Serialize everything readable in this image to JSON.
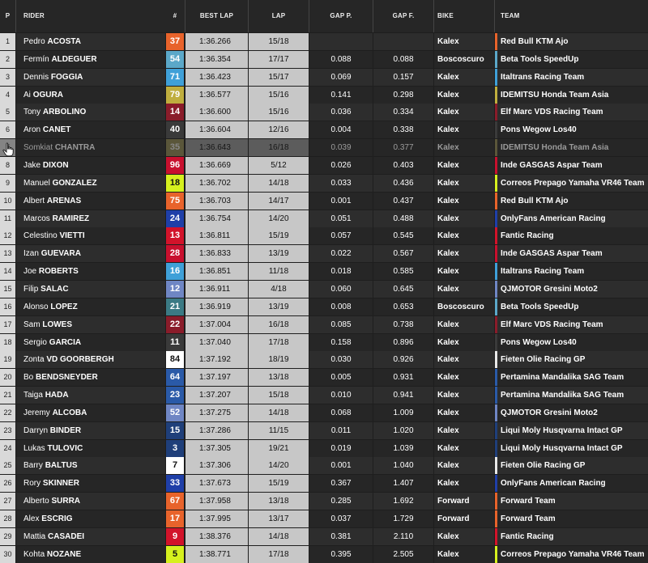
{
  "header": {
    "pos": "P",
    "rider": "RIDER",
    "num": "#",
    "best_lap": "BEST LAP",
    "lap": "LAP",
    "gap_p": "GAP P.",
    "gap_f": "GAP F.",
    "bike": "BIKE",
    "team": "TEAM"
  },
  "rows": [
    {
      "pos": "1",
      "first": "Pedro",
      "last": "ACOSTA",
      "num": "37",
      "num_bg": "#e8632b",
      "num_fg": "#ffffff",
      "best": "1:36.266",
      "lap": "15/18",
      "gap_p": "",
      "gap_f": "",
      "bike": "Kalex",
      "team": "Red Bull KTM Ajo",
      "team_color": "#e8632b"
    },
    {
      "pos": "2",
      "first": "Fermín",
      "last": "ALDEGUER",
      "num": "54",
      "num_bg": "#5ba8c9",
      "num_fg": "#ffffff",
      "best": "1:36.354",
      "lap": "17/17",
      "gap_p": "0.088",
      "gap_f": "0.088",
      "bike": "Boscoscuro",
      "team": "Beta Tools SpeedUp",
      "team_color": "#5ba8c9"
    },
    {
      "pos": "3",
      "first": "Dennis",
      "last": "FOGGIA",
      "num": "71",
      "num_bg": "#3fa0d8",
      "num_fg": "#ffffff",
      "best": "1:36.423",
      "lap": "15/17",
      "gap_p": "0.069",
      "gap_f": "0.157",
      "bike": "Kalex",
      "team": "Italtrans Racing Team",
      "team_color": "#3fa0d8"
    },
    {
      "pos": "4",
      "first": "Ai",
      "last": "OGURA",
      "num": "79",
      "num_bg": "#bfae3e",
      "num_fg": "#ffffff",
      "best": "1:36.577",
      "lap": "15/16",
      "gap_p": "0.141",
      "gap_f": "0.298",
      "bike": "Kalex",
      "team": "IDEMITSU Honda Team Asia",
      "team_color": "#bfae3e"
    },
    {
      "pos": "5",
      "first": "Tony",
      "last": "ARBOLINO",
      "num": "14",
      "num_bg": "#8a1c2a",
      "num_fg": "#ffffff",
      "best": "1:36.600",
      "lap": "15/16",
      "gap_p": "0.036",
      "gap_f": "0.334",
      "bike": "Kalex",
      "team": "Elf Marc VDS Racing Team",
      "team_color": "#8a1c2a"
    },
    {
      "pos": "6",
      "first": "Aron",
      "last": "CANET",
      "num": "40",
      "num_bg": "#3a3a3a",
      "num_fg": "#ffffff",
      "best": "1:36.604",
      "lap": "12/16",
      "gap_p": "0.004",
      "gap_f": "0.338",
      "bike": "Kalex",
      "team": "Pons Wegow Los40",
      "team_color": "#3a3a3a"
    },
    {
      "pos": "7",
      "first": "Somkiat",
      "last": "CHANTRA",
      "num": "35",
      "num_bg": "#8c8452",
      "num_fg": "#dddddd",
      "best": "1:36.643",
      "lap": "16/18",
      "gap_p": "0.039",
      "gap_f": "0.377",
      "bike": "Kalex",
      "team": "IDEMITSU Honda Team Asia",
      "team_color": "#8c8452",
      "dim": true
    },
    {
      "pos": "8",
      "first": "Jake",
      "last": "DIXON",
      "num": "96",
      "num_bg": "#c8102e",
      "num_fg": "#ffffff",
      "best": "1:36.669",
      "lap": "5/12",
      "gap_p": "0.026",
      "gap_f": "0.403",
      "bike": "Kalex",
      "team": "Inde GASGAS Aspar Team",
      "team_color": "#c8102e"
    },
    {
      "pos": "9",
      "first": "Manuel",
      "last": "GONZALEZ",
      "num": "18",
      "num_bg": "#d6f01e",
      "num_fg": "#111111",
      "best": "1:36.702",
      "lap": "14/18",
      "gap_p": "0.033",
      "gap_f": "0.436",
      "bike": "Kalex",
      "team": "Correos Prepago Yamaha VR46 Team",
      "team_color": "#d6f01e"
    },
    {
      "pos": "10",
      "first": "Albert",
      "last": "ARENAS",
      "num": "75",
      "num_bg": "#e8632b",
      "num_fg": "#ffffff",
      "best": "1:36.703",
      "lap": "14/17",
      "gap_p": "0.001",
      "gap_f": "0.437",
      "bike": "Kalex",
      "team": "Red Bull KTM Ajo",
      "team_color": "#e8632b"
    },
    {
      "pos": "11",
      "first": "Marcos",
      "last": "RAMIREZ",
      "num": "24",
      "num_bg": "#1f3fa8",
      "num_fg": "#ffffff",
      "best": "1:36.754",
      "lap": "14/20",
      "gap_p": "0.051",
      "gap_f": "0.488",
      "bike": "Kalex",
      "team": "OnlyFans American Racing",
      "team_color": "#1f3fa8"
    },
    {
      "pos": "12",
      "first": "Celestino",
      "last": "VIETTI",
      "num": "13",
      "num_bg": "#d2132a",
      "num_fg": "#ffffff",
      "best": "1:36.811",
      "lap": "15/19",
      "gap_p": "0.057",
      "gap_f": "0.545",
      "bike": "Kalex",
      "team": "Fantic Racing",
      "team_color": "#d2132a"
    },
    {
      "pos": "13",
      "first": "Izan",
      "last": "GUEVARA",
      "num": "28",
      "num_bg": "#c8102e",
      "num_fg": "#ffffff",
      "best": "1:36.833",
      "lap": "13/19",
      "gap_p": "0.022",
      "gap_f": "0.567",
      "bike": "Kalex",
      "team": "Inde GASGAS Aspar Team",
      "team_color": "#c8102e"
    },
    {
      "pos": "14",
      "first": "Joe",
      "last": "ROBERTS",
      "num": "16",
      "num_bg": "#3fa0d8",
      "num_fg": "#ffffff",
      "best": "1:36.851",
      "lap": "11/18",
      "gap_p": "0.018",
      "gap_f": "0.585",
      "bike": "Kalex",
      "team": "Italtrans Racing Team",
      "team_color": "#3fa0d8"
    },
    {
      "pos": "15",
      "first": "Filip",
      "last": "SALAC",
      "num": "12",
      "num_bg": "#6f86c4",
      "num_fg": "#ffffff",
      "best": "1:36.911",
      "lap": "4/18",
      "gap_p": "0.060",
      "gap_f": "0.645",
      "bike": "Kalex",
      "team": "QJMOTOR Gresini Moto2",
      "team_color": "#6f86c4"
    },
    {
      "pos": "16",
      "first": "Alonso",
      "last": "LOPEZ",
      "num": "21",
      "num_bg": "#3b7a84",
      "num_fg": "#ffffff",
      "best": "1:36.919",
      "lap": "13/19",
      "gap_p": "0.008",
      "gap_f": "0.653",
      "bike": "Boscoscuro",
      "team": "Beta Tools SpeedUp",
      "team_color": "#5ba8c9"
    },
    {
      "pos": "17",
      "first": "Sam",
      "last": "LOWES",
      "num": "22",
      "num_bg": "#8a1c2a",
      "num_fg": "#ffffff",
      "best": "1:37.004",
      "lap": "16/18",
      "gap_p": "0.085",
      "gap_f": "0.738",
      "bike": "Kalex",
      "team": "Elf Marc VDS Racing Team",
      "team_color": "#8a1c2a"
    },
    {
      "pos": "18",
      "first": "Sergio",
      "last": "GARCIA",
      "num": "11",
      "num_bg": "#3a3a3a",
      "num_fg": "#ffffff",
      "best": "1:37.040",
      "lap": "17/18",
      "gap_p": "0.158",
      "gap_f": "0.896",
      "bike": "Kalex",
      "team": "Pons Wegow Los40",
      "team_color": "#3a3a3a"
    },
    {
      "pos": "19",
      "first": "Zonta",
      "last": "VD GOORBERGH",
      "num": "84",
      "num_bg": "#ffffff",
      "num_fg": "#111111",
      "best": "1:37.192",
      "lap": "18/19",
      "gap_p": "0.030",
      "gap_f": "0.926",
      "bike": "Kalex",
      "team": "Fieten Olie Racing GP",
      "team_color": "#e8e8e8"
    },
    {
      "pos": "20",
      "first": "Bo",
      "last": "BENDSNEYDER",
      "num": "64",
      "num_bg": "#2a5aa8",
      "num_fg": "#ffffff",
      "best": "1:37.197",
      "lap": "13/18",
      "gap_p": "0.005",
      "gap_f": "0.931",
      "bike": "Kalex",
      "team": "Pertamina Mandalika SAG Team",
      "team_color": "#2a5aa8"
    },
    {
      "pos": "21",
      "first": "Taiga",
      "last": "HADA",
      "num": "23",
      "num_bg": "#2a5aa8",
      "num_fg": "#ffffff",
      "best": "1:37.207",
      "lap": "15/18",
      "gap_p": "0.010",
      "gap_f": "0.941",
      "bike": "Kalex",
      "team": "Pertamina Mandalika SAG Team",
      "team_color": "#2a5aa8"
    },
    {
      "pos": "22",
      "first": "Jeremy",
      "last": "ALCOBA",
      "num": "52",
      "num_bg": "#6f86c4",
      "num_fg": "#ffffff",
      "best": "1:37.275",
      "lap": "14/18",
      "gap_p": "0.068",
      "gap_f": "1.009",
      "bike": "Kalex",
      "team": "QJMOTOR Gresini Moto2",
      "team_color": "#6f86c4"
    },
    {
      "pos": "23",
      "first": "Darryn",
      "last": "BINDER",
      "num": "15",
      "num_bg": "#1f3f7a",
      "num_fg": "#ffffff",
      "best": "1:37.286",
      "lap": "11/15",
      "gap_p": "0.011",
      "gap_f": "1.020",
      "bike": "Kalex",
      "team": "Liqui Moly Husqvarna Intact GP",
      "team_color": "#1f3f7a"
    },
    {
      "pos": "24",
      "first": "Lukas",
      "last": "TULOVIC",
      "num": "3",
      "num_bg": "#1f3f7a",
      "num_fg": "#ffffff",
      "best": "1:37.305",
      "lap": "19/21",
      "gap_p": "0.019",
      "gap_f": "1.039",
      "bike": "Kalex",
      "team": "Liqui Moly Husqvarna Intact GP",
      "team_color": "#1f3f7a"
    },
    {
      "pos": "25",
      "first": "Barry",
      "last": "BALTUS",
      "num": "7",
      "num_bg": "#ffffff",
      "num_fg": "#111111",
      "best": "1:37.306",
      "lap": "14/20",
      "gap_p": "0.001",
      "gap_f": "1.040",
      "bike": "Kalex",
      "team": "Fieten Olie Racing GP",
      "team_color": "#e8e8e8"
    },
    {
      "pos": "26",
      "first": "Rory",
      "last": "SKINNER",
      "num": "33",
      "num_bg": "#1f3fa8",
      "num_fg": "#ffffff",
      "best": "1:37.673",
      "lap": "15/19",
      "gap_p": "0.367",
      "gap_f": "1.407",
      "bike": "Kalex",
      "team": "OnlyFans American Racing",
      "team_color": "#1f3fa8"
    },
    {
      "pos": "27",
      "first": "Alberto",
      "last": "SURRA",
      "num": "67",
      "num_bg": "#e8632b",
      "num_fg": "#ffffff",
      "best": "1:37.958",
      "lap": "13/18",
      "gap_p": "0.285",
      "gap_f": "1.692",
      "bike": "Forward",
      "team": "Forward Team",
      "team_color": "#e8632b"
    },
    {
      "pos": "28",
      "first": "Alex",
      "last": "ESCRIG",
      "num": "17",
      "num_bg": "#e8632b",
      "num_fg": "#ffffff",
      "best": "1:37.995",
      "lap": "13/17",
      "gap_p": "0.037",
      "gap_f": "1.729",
      "bike": "Forward",
      "team": "Forward Team",
      "team_color": "#e8632b"
    },
    {
      "pos": "29",
      "first": "Mattia",
      "last": "CASADEI",
      "num": "9",
      "num_bg": "#d2132a",
      "num_fg": "#ffffff",
      "best": "1:38.376",
      "lap": "14/18",
      "gap_p": "0.381",
      "gap_f": "2.110",
      "bike": "Kalex",
      "team": "Fantic Racing",
      "team_color": "#d2132a"
    },
    {
      "pos": "30",
      "first": "Kohta",
      "last": "NOZANE",
      "num": "5",
      "num_bg": "#d6f01e",
      "num_fg": "#111111",
      "best": "1:38.771",
      "lap": "17/18",
      "gap_p": "0.395",
      "gap_f": "2.505",
      "bike": "Kalex",
      "team": "Correos Prepago Yamaha VR46 Team",
      "team_color": "#d6f01e"
    }
  ]
}
